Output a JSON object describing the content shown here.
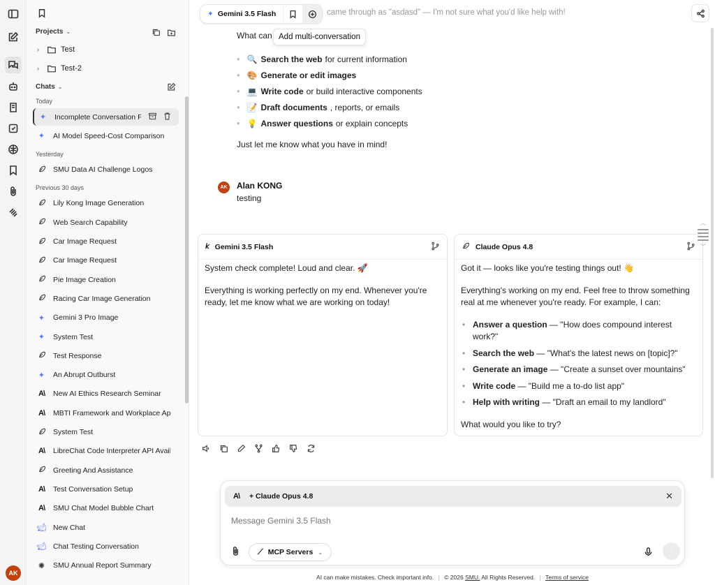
{
  "rail": {
    "icons": [
      "sidebar-toggle-icon",
      "new-chat-icon",
      "chats-icon",
      "agents-icon",
      "prompts-icon",
      "memories-icon",
      "brain-icon",
      "bookmarks-icon",
      "files-icon",
      "mcp-icon"
    ],
    "avatar": "AK"
  },
  "sidebar": {
    "projects_label": "Projects",
    "projects": [
      "Test",
      "Test-2"
    ],
    "chats_label": "Chats",
    "groups": [
      {
        "label": "Today",
        "items": [
          {
            "title": "Incomplete Conversation Fragment",
            "icon": "gemini"
          },
          {
            "title": "AI Model Speed-Cost Comparison",
            "icon": "gemini"
          }
        ]
      },
      {
        "label": "Yesterday",
        "items": [
          {
            "title": "SMU Data AI Challenge Logos",
            "icon": "feather"
          }
        ]
      },
      {
        "label": "Previous 30 days",
        "items": [
          {
            "title": "Lily Kong Image Generation",
            "icon": "feather"
          },
          {
            "title": "Web Search Capability",
            "icon": "feather"
          },
          {
            "title": "Car Image Request",
            "icon": "feather"
          },
          {
            "title": "Car Image Request",
            "icon": "feather"
          },
          {
            "title": "Pie Image Creation",
            "icon": "feather"
          },
          {
            "title": "Racing Car Image Generation",
            "icon": "feather"
          },
          {
            "title": "Gemini 3 Pro Image",
            "icon": "gemini"
          },
          {
            "title": "System Test",
            "icon": "gemini"
          },
          {
            "title": "Test Response",
            "icon": "feather"
          },
          {
            "title": "An Abrupt Outburst",
            "icon": "gemini"
          },
          {
            "title": "New AI Ethics Research Seminar",
            "icon": "anthropic"
          },
          {
            "title": "MBTI Framework and Workplace Ap",
            "icon": "anthropic"
          },
          {
            "title": "System Test",
            "icon": "feather"
          },
          {
            "title": "LibreChat Code Interpreter API Avail",
            "icon": "anthropic"
          },
          {
            "title": "Greeting And Assistance",
            "icon": "feather"
          },
          {
            "title": "Test Conversation Setup",
            "icon": "anthropic"
          },
          {
            "title": "SMU Chat Model Bubble Chart",
            "icon": "anthropic"
          },
          {
            "title": "New Chat",
            "icon": "deepseek"
          },
          {
            "title": "Chat Testing Conversation",
            "icon": "deepseek"
          },
          {
            "title": "SMU Annual Report Summary",
            "icon": "openai"
          }
        ]
      }
    ]
  },
  "topbar": {
    "model": "Gemini 3.5 Flash",
    "tooltip": "Add multi-conversation",
    "faded_text": "came through as \"asdasd\" — I'm not sure what you'd like help with!"
  },
  "assistant_msg": {
    "intro": "What can",
    "capabilities": [
      {
        "emoji": "🔍",
        "bold": "Search the web",
        "rest": "for current information"
      },
      {
        "emoji": "🎨",
        "bold": "Generate or edit images",
        "rest": ""
      },
      {
        "emoji": "💻",
        "bold": "Write code",
        "rest": "or build interactive components"
      },
      {
        "emoji": "📝",
        "bold": "Draft documents",
        "rest": ", reports, or emails"
      },
      {
        "emoji": "💡",
        "bold": "Answer questions",
        "rest": "or explain concepts"
      }
    ],
    "outro": "Just let me know what you have in mind!"
  },
  "user_msg": {
    "avatar": "AK",
    "name": "Alan KONG",
    "text": "testing"
  },
  "cards": [
    {
      "model": "Gemini 3.5 Flash",
      "paragraphs": [
        "System check complete! Loud and clear. 🚀",
        "Everything is working perfectly on my end. Whenever you're ready, let me know what we are working on today!"
      ]
    },
    {
      "model": "Claude Opus 4.8",
      "intro": "Got it — looks like you're testing things out! 👋",
      "para": "Everything's working on my end. Feel free to throw something real at me whenever you're ready. For example, I can:",
      "bullets": [
        {
          "bold": "Answer a question",
          "rest": " — \"How does compound interest work?\""
        },
        {
          "bold": "Search the web",
          "rest": " — \"What's the latest news on [topic]?\""
        },
        {
          "bold": "Generate an image",
          "rest": " — \"Create a sunset over mountains\""
        },
        {
          "bold": "Write code",
          "rest": " — \"Build me a to-do list app\""
        },
        {
          "bold": "Help with writing",
          "rest": " — \"Draft an email to my landlord\""
        }
      ],
      "outro": "What would you like to try?"
    }
  ],
  "composer": {
    "added_model": "+ Claude Opus 4.8",
    "placeholder": "Message Gemini 3.5 Flash",
    "mcp_label": "MCP Servers"
  },
  "footer": {
    "disclaimer": "AI can make mistakes. Check important info.",
    "copyright": "© 2026",
    "org": "SMU.",
    "rights": "All Rights Reserved.",
    "terms": "Terms of service"
  },
  "colors": {
    "avatar": "#c2410c",
    "gemini": "#4f7cf7"
  }
}
